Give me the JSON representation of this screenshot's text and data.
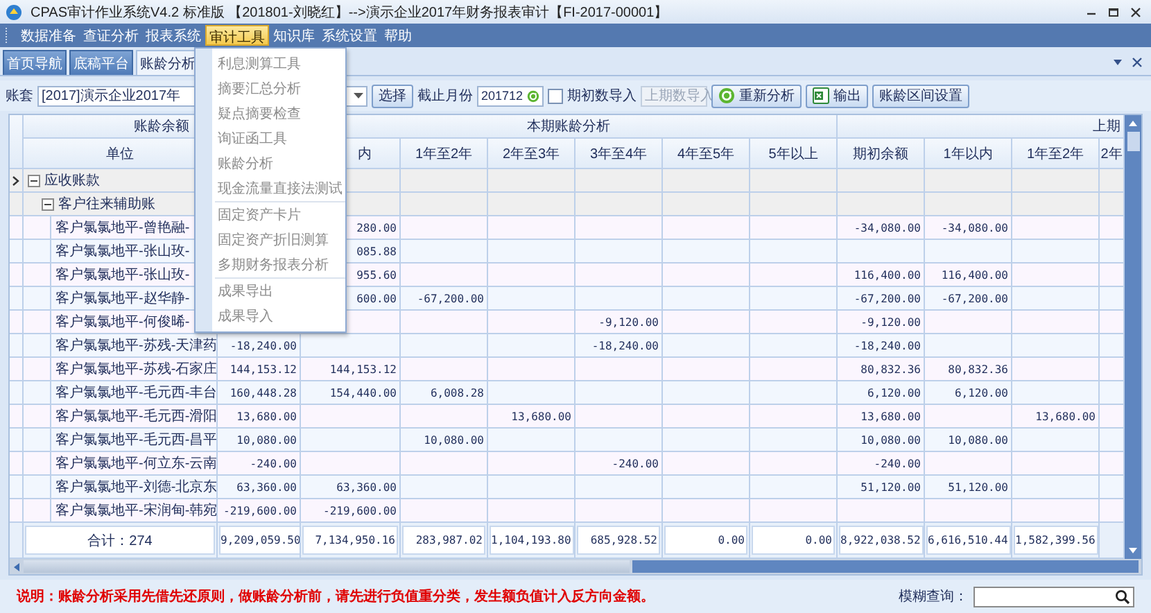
{
  "window": {
    "title": "CPAS审计作业系统V4.2 标准版 【201801-刘晓红】-->演示企业2017年财务报表审计【FI-2017-00001】"
  },
  "menubar": [
    {
      "label": "数据准备",
      "selected": false
    },
    {
      "label": "查证分析",
      "selected": false
    },
    {
      "label": "报表系统",
      "selected": false
    },
    {
      "label": "审计工具",
      "selected": true
    },
    {
      "label": "知识库",
      "selected": false
    },
    {
      "label": "系统设置",
      "selected": false
    },
    {
      "label": "帮助",
      "selected": false
    }
  ],
  "menu": {
    "groups": [
      [
        "利息测算工具",
        "摘要汇总分析",
        "疑点摘要检查",
        "询证函工具",
        "账龄分析",
        "现金流量直接法测试"
      ],
      [
        "固定资产卡片",
        "固定资产折旧测算",
        "多期财务报表分析"
      ],
      [
        "成果导出",
        "成果导入"
      ]
    ]
  },
  "tabs": [
    {
      "label": "首页导航",
      "selected": false
    },
    {
      "label": "底稿平台",
      "selected": false
    },
    {
      "label": "账龄分析",
      "selected": true
    }
  ],
  "toolbar": {
    "ledger_label": "账套",
    "ledger_value": "[2017]演示企业2017年",
    "select_button": "选择",
    "month_label": "截止月份",
    "month_value": "201712",
    "opening_import": {
      "label": "期初数导入",
      "checked": false
    },
    "prior_import": {
      "value": "上期数导入",
      "disabled": true
    },
    "buttons": [
      {
        "label": "重新分析",
        "kind": "refresh"
      },
      {
        "label": "输出",
        "kind": "excel"
      },
      {
        "label": "账龄区间设置",
        "kind": "plain"
      }
    ]
  },
  "table": {
    "groups": [
      {
        "label": "账龄余额",
        "columns": [
          "单位",
          null
        ]
      },
      {
        "label": "本期账龄分析",
        "columns": [
          "内",
          "1年至2年",
          "2年至3年",
          "3年至4年",
          "4年至5年",
          "5年以上"
        ]
      },
      {
        "label": "上期",
        "columns": [
          "期初余额",
          "1年以内",
          "1年至2年",
          "2年"
        ]
      }
    ],
    "tree": [
      {
        "label": "应收账款",
        "expanded": true,
        "selected": true,
        "children": [
          {
            "label": "客户往来辅助账",
            "expanded": true,
            "selected": false,
            "children": [
              {
                "name": "客户氯氯地平-曾艳融-",
                "selected": false,
                "cells": [
                  null,
                  "280.00",
                  null,
                  null,
                  null,
                  null,
                  null,
                  "-34,080.00",
                  "-34,080.00",
                  null
                ]
              },
              {
                "name": "客户氯氯地平-张山玫-",
                "selected": false,
                "cells": [
                  null,
                  "085.88",
                  null,
                  null,
                  null,
                  null,
                  null,
                  null,
                  null,
                  null
                ]
              },
              {
                "name": "客户氯氯地平-张山玫-",
                "selected": false,
                "cells": [
                  null,
                  "955.60",
                  null,
                  null,
                  null,
                  null,
                  null,
                  "116,400.00",
                  "116,400.00",
                  null
                ]
              },
              {
                "name": "客户氯氯地平-赵华静-",
                "selected": false,
                "cells": [
                  null,
                  "600.00",
                  "-67,200.00",
                  null,
                  null,
                  null,
                  null,
                  "-67,200.00",
                  "-67,200.00",
                  null
                ]
              },
              {
                "name": "客户氯氯地平-何俊晞-",
                "selected": false,
                "cells": [
                  null,
                  null,
                  null,
                  null,
                  "-9,120.00",
                  null,
                  null,
                  "-9,120.00",
                  null,
                  null
                ]
              },
              {
                "name": "客户氯氯地平-苏残-天津药",
                "selected": false,
                "cells": [
                  "-18,240.00",
                  null,
                  null,
                  null,
                  "-18,240.00",
                  null,
                  null,
                  "-18,240.00",
                  null,
                  null
                ]
              },
              {
                "name": "客户氯氯地平-苏残-石家庄",
                "selected": false,
                "cells": [
                  "144,153.12",
                  "144,153.12",
                  null,
                  null,
                  null,
                  null,
                  null,
                  "80,832.36",
                  "80,832.36",
                  null
                ]
              },
              {
                "name": "客户氯氯地平-毛元西-丰台",
                "selected": false,
                "cells": [
                  "160,448.28",
                  "154,440.00",
                  "6,008.28",
                  null,
                  null,
                  null,
                  null,
                  "6,120.00",
                  "6,120.00",
                  null
                ]
              },
              {
                "name": "客户氯氯地平-毛元西-滑阳",
                "selected": false,
                "cells": [
                  "13,680.00",
                  null,
                  null,
                  "13,680.00",
                  null,
                  null,
                  null,
                  "13,680.00",
                  null,
                  "13,680.00"
                ]
              },
              {
                "name": "客户氯氯地平-毛元西-昌平",
                "selected": false,
                "cells": [
                  "10,080.00",
                  null,
                  "10,080.00",
                  null,
                  null,
                  null,
                  null,
                  "10,080.00",
                  "10,080.00",
                  null
                ]
              },
              {
                "name": "客户氯氯地平-何立东-云南",
                "selected": false,
                "cells": [
                  "-240.00",
                  null,
                  null,
                  null,
                  "-240.00",
                  null,
                  null,
                  "-240.00",
                  null,
                  null
                ]
              },
              {
                "name": "客户氯氯地平-刘德-北京东",
                "selected": false,
                "cells": [
                  "63,360.00",
                  "63,360.00",
                  null,
                  null,
                  null,
                  null,
                  null,
                  "51,120.00",
                  "51,120.00",
                  null
                ]
              },
              {
                "name": "客户氯氯地平-宋润甸-韩宛",
                "selected": false,
                "cells": [
                  "-219,600.00",
                  "-219,600.00",
                  null,
                  null,
                  null,
                  null,
                  null,
                  null,
                  null,
                  null
                ]
              }
            ]
          }
        ]
      }
    ],
    "total": {
      "label": "合计：274",
      "values": [
        "9,209,059.50",
        "7,134,950.16",
        "283,987.02",
        "1,104,193.80",
        "685,928.52",
        "0.00",
        "0.00",
        "8,922,038.52",
        "6,616,510.44",
        "1,582,399.56"
      ]
    }
  },
  "footer": {
    "note": "说明：账龄分析采用先借先还原则，做账龄分析前，请先进行负值重分类，发生额负值计入反方向金额。",
    "search_label": "模糊查询："
  }
}
